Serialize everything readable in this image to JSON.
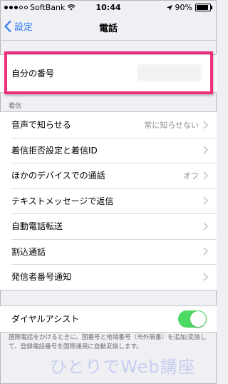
{
  "status_bar": {
    "carrier": "SoftBank",
    "time": "10:44",
    "battery": "90%"
  },
  "nav": {
    "back_label": "設定",
    "title": "電話"
  },
  "my_number": {
    "label": "自分の番号"
  },
  "incoming_section": {
    "header": "着信",
    "rows": [
      {
        "label": "音声で知らせる",
        "value": "常に知らせない"
      },
      {
        "label": "着信拒否設定と着信ID",
        "value": ""
      },
      {
        "label": "ほかのデバイスでの通話",
        "value": "オフ"
      },
      {
        "label": "テキストメッセージで返信",
        "value": ""
      },
      {
        "label": "自動電話転送",
        "value": ""
      },
      {
        "label": "割込通話",
        "value": ""
      },
      {
        "label": "発信者番号通知",
        "value": ""
      }
    ]
  },
  "dial_assist": {
    "label": "ダイヤルアシスト",
    "enabled": true,
    "footer": "国際電話をかけるときに、国番号と地域番号（市外局番）を追加/変換して、登録電話番号を国際通用に自動変換します。"
  },
  "watermark": "ひとりでWeb講座",
  "colors": {
    "accent": "#2f7cf6",
    "toggle_on": "#4cd964",
    "highlight": "#ef2d7b"
  }
}
